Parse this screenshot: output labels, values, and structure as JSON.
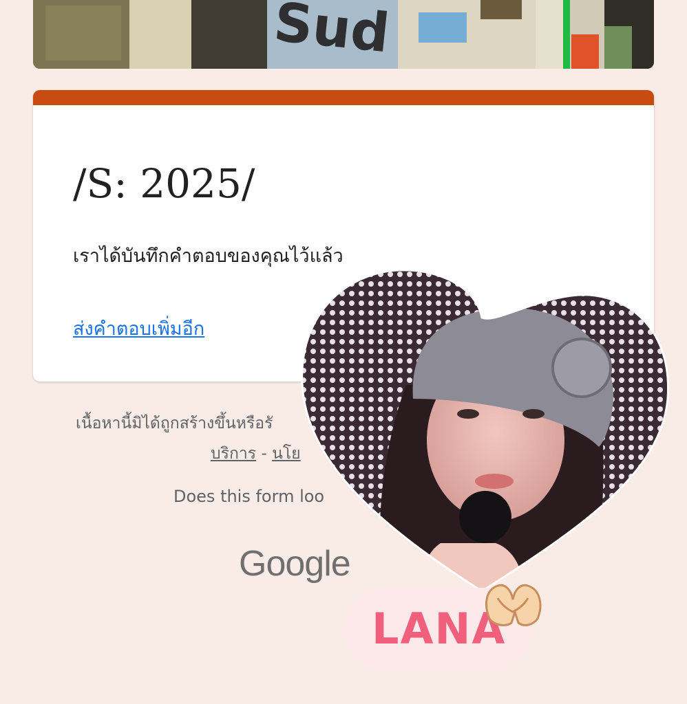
{
  "banner": {
    "collage_text": "Sud"
  },
  "card": {
    "accent_color": "#c84b11",
    "title": "/S: 2025/",
    "confirmation": "เราได้บันทึกคำตอบของคุณไว้แล้ว",
    "submit_another_link": "ส่งคำตอบเพิ่มอีก"
  },
  "footer": {
    "note": "เนื้อหานี้มิได้ถูกสร้างขึ้นหรือรั",
    "links": {
      "terms": "บริการ",
      "sep": "-",
      "privacy": "นโย"
    },
    "report_text": "Does this form loo",
    "logo_text": "Google"
  },
  "sticker": {
    "label": "LANA",
    "label_color": "#f0607c",
    "label_bg": "#fde9ea",
    "decoration": "heart-hands-icon"
  }
}
